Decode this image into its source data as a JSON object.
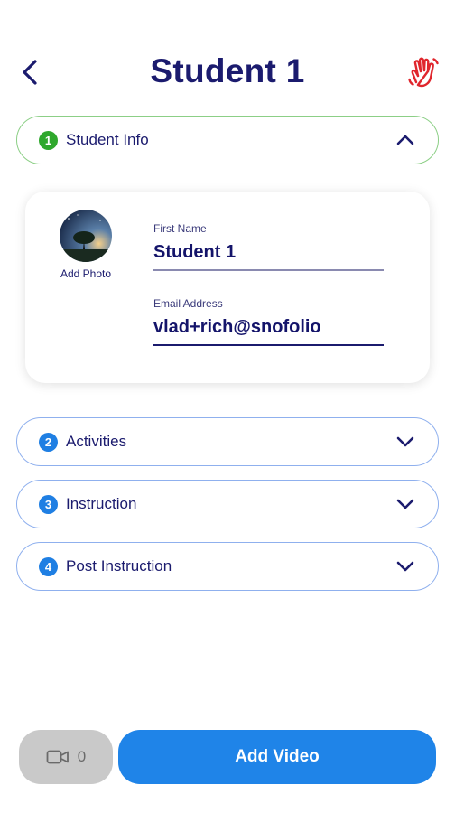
{
  "header": {
    "title": "Student 1",
    "back_icon": "chevron-left-icon",
    "help_icon": "raised-hand-icon",
    "help_icon_color": "#e0262d"
  },
  "sections": [
    {
      "number": "1",
      "label": "Student Info",
      "expanded": true,
      "accent": "#2fa82d"
    },
    {
      "number": "2",
      "label": "Activities",
      "expanded": false,
      "accent": "#1f7fe3"
    },
    {
      "number": "3",
      "label": "Instruction",
      "expanded": false,
      "accent": "#1f7fe3"
    },
    {
      "number": "4",
      "label": "Post Instruction",
      "expanded": false,
      "accent": "#1f7fe3"
    }
  ],
  "student_info": {
    "add_photo_label": "Add Photo",
    "first_name_label": "First Name",
    "first_name_value": "Student 1",
    "email_label": "Email Address",
    "email_value": "vlad+rich@snofolio"
  },
  "footer": {
    "video_count": "0",
    "video_icon": "video-camera-icon",
    "add_video_label": "Add Video",
    "brand_color": "#1f84e8"
  }
}
